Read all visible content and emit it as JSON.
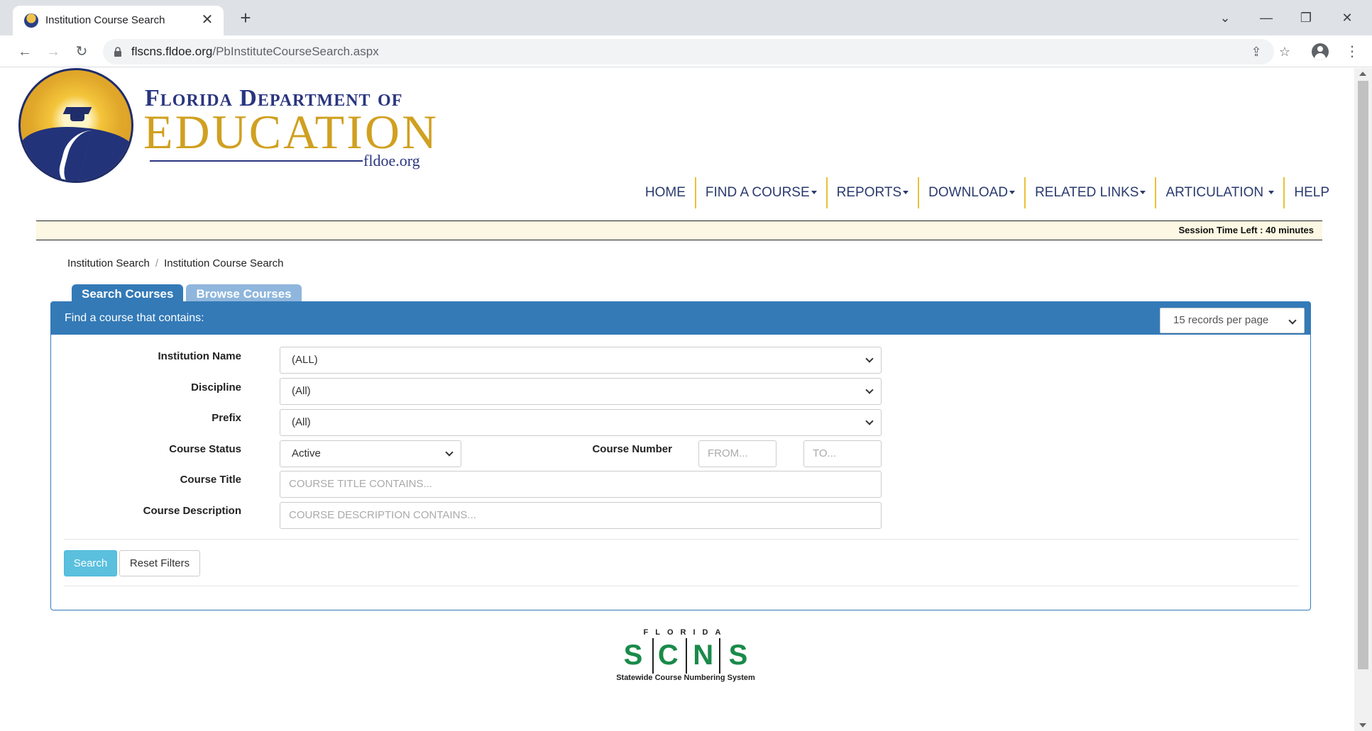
{
  "browser": {
    "tab_title": "Institution Course Search",
    "url_host": "flscns.fldoe.org",
    "url_path": "/PbInstituteCourseSearch.aspx"
  },
  "logo": {
    "line1": "Florida Department of",
    "line2": "EDUCATION",
    "url": "fldoe.org"
  },
  "nav": {
    "home": "HOME",
    "find_course": "FIND A COURSE",
    "reports": "REPORTS",
    "download": "DOWNLOAD",
    "related_links": "RELATED LINKS",
    "articulation": "ARTICULATION",
    "help": "HELP"
  },
  "session": "Session Time Left : 40 minutes",
  "breadcrumb": {
    "item1": "Institution Search",
    "item2": "Institution Course Search"
  },
  "tabs": {
    "search": "Search Courses",
    "browse": "Browse Courses"
  },
  "panel": {
    "title": "Find a course that contains:",
    "per_page": "15 records per page"
  },
  "form": {
    "institution_label": "Institution Name",
    "institution_value": "(ALL)",
    "discipline_label": "Discipline",
    "discipline_value": "(All)",
    "prefix_label": "Prefix",
    "prefix_value": "(All)",
    "status_label": "Course Status",
    "status_value": "Active",
    "number_label": "Course Number",
    "number_from": "FROM...",
    "number_to": "TO...",
    "title_label": "Course Title",
    "title_placeholder": "COURSE TITLE CONTAINS...",
    "desc_label": "Course Description",
    "desc_placeholder": "COURSE DESCRIPTION CONTAINS...",
    "search_button": "Search",
    "reset_button": "Reset Filters"
  },
  "scns": {
    "top": "FLORIDA",
    "letters": [
      "S",
      "C",
      "N",
      "S"
    ],
    "subtitle": "Statewide Course Numbering System"
  },
  "icons": {
    "back": "arrow-left-icon",
    "forward": "arrow-right-icon",
    "reload": "reload-icon",
    "lock": "lock-icon",
    "share": "share-icon",
    "star": "star-icon",
    "profile": "avatar-icon",
    "menu": "more-vert-icon"
  }
}
